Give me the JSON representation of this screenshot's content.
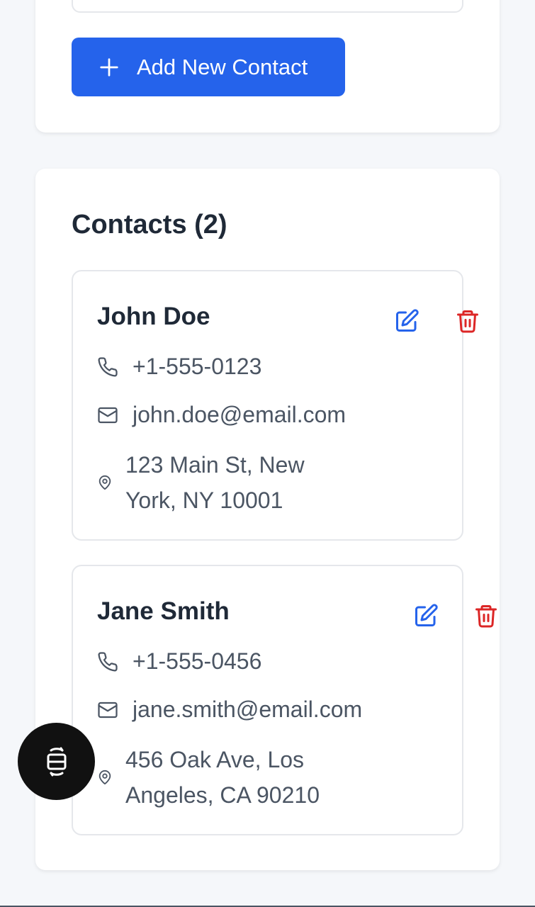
{
  "add_button": {
    "label": "Add New Contact",
    "icon": "plus-icon"
  },
  "contacts_section": {
    "title": "Contacts (2)",
    "contacts": [
      {
        "name": "John Doe",
        "phone": "+1-555-0123",
        "email": "john.doe@email.com",
        "address": "123 Main St, New York, NY 10001"
      },
      {
        "name": "Jane Smith",
        "phone": "+1-555-0456",
        "email": "jane.smith@email.com",
        "address": "456 Oak Ave, Los Angeles, CA 90210"
      }
    ]
  },
  "colors": {
    "accent": "#2563eb",
    "danger": "#dc2626",
    "text": "#1f2937",
    "muted": "#4b5563"
  },
  "fab": {
    "icon": "screen-rotate-icon"
  }
}
